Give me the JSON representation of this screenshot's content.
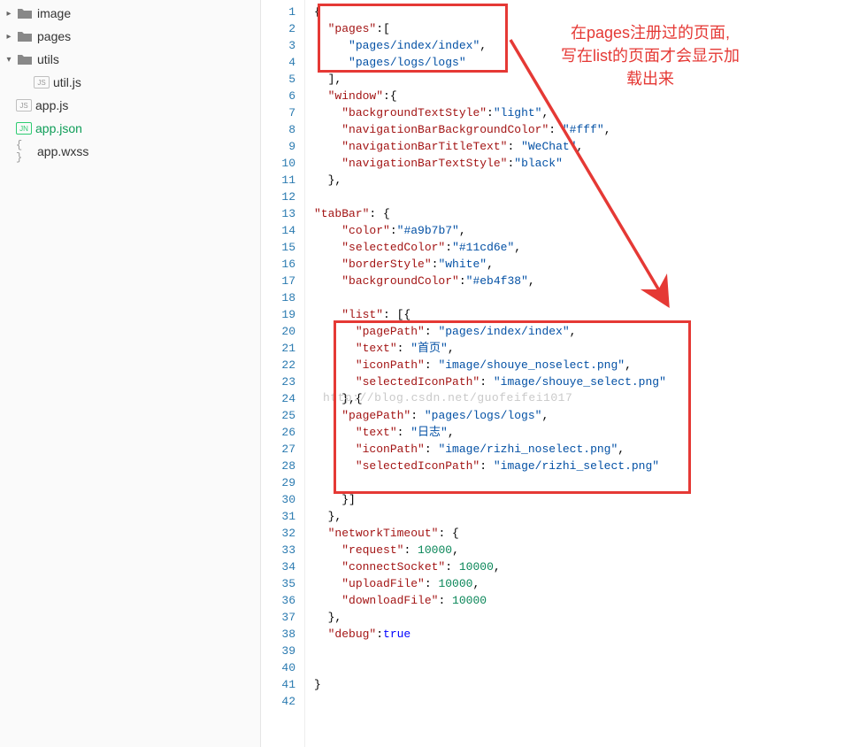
{
  "tree": {
    "image": "image",
    "pages": "pages",
    "utils": "utils",
    "utiljs": "util.js",
    "appjs": "app.js",
    "appjson": "app.json",
    "appwxss": "app.wxss"
  },
  "annotation": {
    "line1": "在pages注册过的页面,",
    "line2": "写在list的页面才会显示加",
    "line3": "载出来"
  },
  "watermark": "http://blog.csdn.net/guofeifei1017",
  "lineCount": 42,
  "code": [
    [
      [
        "brace",
        "{"
      ]
    ],
    [
      [
        "punc",
        "  "
      ],
      [
        "key",
        "\"pages\""
      ],
      [
        "punc",
        ":["
      ]
    ],
    [
      [
        "punc",
        "     "
      ],
      [
        "str",
        "\"pages/index/index\""
      ],
      [
        "punc",
        ","
      ]
    ],
    [
      [
        "punc",
        "     "
      ],
      [
        "str",
        "\"pages/logs/logs\""
      ]
    ],
    [
      [
        "punc",
        "  ],"
      ]
    ],
    [
      [
        "punc",
        "  "
      ],
      [
        "key",
        "\"window\""
      ],
      [
        "punc",
        ":{"
      ]
    ],
    [
      [
        "punc",
        "    "
      ],
      [
        "key",
        "\"backgroundTextStyle\""
      ],
      [
        "punc",
        ":"
      ],
      [
        "str",
        "\"light\""
      ],
      [
        "punc",
        ","
      ]
    ],
    [
      [
        "punc",
        "    "
      ],
      [
        "key",
        "\"navigationBarBackgroundColor\""
      ],
      [
        "punc",
        ": "
      ],
      [
        "str",
        "\"#fff\""
      ],
      [
        "punc",
        ","
      ]
    ],
    [
      [
        "punc",
        "    "
      ],
      [
        "key",
        "\"navigationBarTitleText\""
      ],
      [
        "punc",
        ": "
      ],
      [
        "str",
        "\"WeChat\""
      ],
      [
        "punc",
        ","
      ]
    ],
    [
      [
        "punc",
        "    "
      ],
      [
        "key",
        "\"navigationBarTextStyle\""
      ],
      [
        "punc",
        ":"
      ],
      [
        "str",
        "\"black\""
      ]
    ],
    [
      [
        "punc",
        "  },"
      ]
    ],
    [],
    [
      [
        "key",
        "\"tabBar\""
      ],
      [
        "punc",
        ": {"
      ]
    ],
    [
      [
        "punc",
        "    "
      ],
      [
        "key",
        "\"color\""
      ],
      [
        "punc",
        ":"
      ],
      [
        "str",
        "\"#a9b7b7\""
      ],
      [
        "punc",
        ","
      ]
    ],
    [
      [
        "punc",
        "    "
      ],
      [
        "key",
        "\"selectedColor\""
      ],
      [
        "punc",
        ":"
      ],
      [
        "str",
        "\"#11cd6e\""
      ],
      [
        "punc",
        ","
      ]
    ],
    [
      [
        "punc",
        "    "
      ],
      [
        "key",
        "\"borderStyle\""
      ],
      [
        "punc",
        ":"
      ],
      [
        "str",
        "\"white\""
      ],
      [
        "punc",
        ","
      ]
    ],
    [
      [
        "punc",
        "    "
      ],
      [
        "key",
        "\"backgroundColor\""
      ],
      [
        "punc",
        ":"
      ],
      [
        "str",
        "\"#eb4f38\""
      ],
      [
        "punc",
        ","
      ]
    ],
    [],
    [
      [
        "punc",
        "    "
      ],
      [
        "key",
        "\"list\""
      ],
      [
        "punc",
        ": [{"
      ]
    ],
    [
      [
        "punc",
        "      "
      ],
      [
        "key",
        "\"pagePath\""
      ],
      [
        "punc",
        ": "
      ],
      [
        "str",
        "\"pages/index/index\""
      ],
      [
        "punc",
        ","
      ]
    ],
    [
      [
        "punc",
        "      "
      ],
      [
        "key",
        "\"text\""
      ],
      [
        "punc",
        ": "
      ],
      [
        "str",
        "\"首页\""
      ],
      [
        "punc",
        ","
      ]
    ],
    [
      [
        "punc",
        "      "
      ],
      [
        "key",
        "\"iconPath\""
      ],
      [
        "punc",
        ": "
      ],
      [
        "str",
        "\"image/shouye_noselect.png\""
      ],
      [
        "punc",
        ","
      ]
    ],
    [
      [
        "punc",
        "      "
      ],
      [
        "key",
        "\"selectedIconPath\""
      ],
      [
        "punc",
        ": "
      ],
      [
        "str",
        "\"image/shouye_select.png\""
      ]
    ],
    [
      [
        "punc",
        "    },{"
      ]
    ],
    [
      [
        "punc",
        "    "
      ],
      [
        "key",
        "\"pagePath\""
      ],
      [
        "punc",
        ": "
      ],
      [
        "str",
        "\"pages/logs/logs\""
      ],
      [
        "punc",
        ","
      ]
    ],
    [
      [
        "punc",
        "      "
      ],
      [
        "key",
        "\"text\""
      ],
      [
        "punc",
        ": "
      ],
      [
        "str",
        "\"日志\""
      ],
      [
        "punc",
        ","
      ]
    ],
    [
      [
        "punc",
        "      "
      ],
      [
        "key",
        "\"iconPath\""
      ],
      [
        "punc",
        ": "
      ],
      [
        "str",
        "\"image/rizhi_noselect.png\""
      ],
      [
        "punc",
        ","
      ]
    ],
    [
      [
        "punc",
        "      "
      ],
      [
        "key",
        "\"selectedIconPath\""
      ],
      [
        "punc",
        ": "
      ],
      [
        "str",
        "\"image/rizhi_select.png\""
      ]
    ],
    [],
    [
      [
        "punc",
        "    }]"
      ]
    ],
    [
      [
        "punc",
        "  },"
      ]
    ],
    [
      [
        "punc",
        "  "
      ],
      [
        "key",
        "\"networkTimeout\""
      ],
      [
        "punc",
        ": {"
      ]
    ],
    [
      [
        "punc",
        "    "
      ],
      [
        "key",
        "\"request\""
      ],
      [
        "punc",
        ": "
      ],
      [
        "num",
        "10000"
      ],
      [
        "punc",
        ","
      ]
    ],
    [
      [
        "punc",
        "    "
      ],
      [
        "key",
        "\"connectSocket\""
      ],
      [
        "punc",
        ": "
      ],
      [
        "num",
        "10000"
      ],
      [
        "punc",
        ","
      ]
    ],
    [
      [
        "punc",
        "    "
      ],
      [
        "key",
        "\"uploadFile\""
      ],
      [
        "punc",
        ": "
      ],
      [
        "num",
        "10000"
      ],
      [
        "punc",
        ","
      ]
    ],
    [
      [
        "punc",
        "    "
      ],
      [
        "key",
        "\"downloadFile\""
      ],
      [
        "punc",
        ": "
      ],
      [
        "num",
        "10000"
      ]
    ],
    [
      [
        "punc",
        "  },"
      ]
    ],
    [
      [
        "punc",
        "  "
      ],
      [
        "key",
        "\"debug\""
      ],
      [
        "punc",
        ":"
      ],
      [
        "bool",
        "true"
      ]
    ],
    [],
    [],
    [
      [
        "brace",
        "}"
      ]
    ],
    []
  ]
}
